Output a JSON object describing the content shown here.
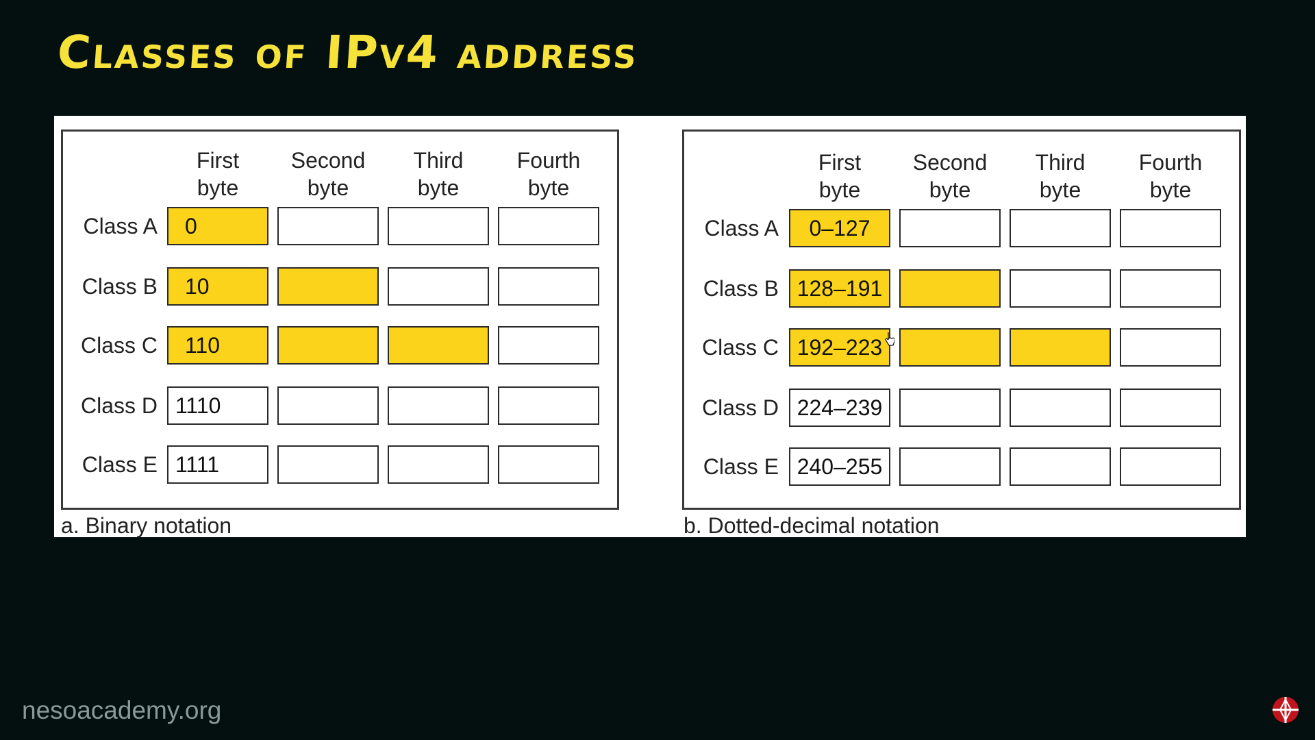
{
  "slide": {
    "title": "Classes of IPv4 address",
    "watermark": "nesoacademy.org"
  },
  "colors": {
    "background": "#03100f",
    "title": "#f7e23a",
    "highlight": "#fbd31a",
    "watermark": "#8a9a98"
  },
  "binary_panel": {
    "caption": "a. Binary notation",
    "columns": [
      "First",
      "byte",
      "Second",
      "byte",
      "Third",
      "byte",
      "Fourth",
      "byte"
    ],
    "rows": [
      {
        "label": "Class A",
        "first_byte": "0",
        "highlighted_bytes": 1
      },
      {
        "label": "Class B",
        "first_byte": "10",
        "highlighted_bytes": 2
      },
      {
        "label": "Class C",
        "first_byte": "110",
        "highlighted_bytes": 3
      },
      {
        "label": "Class D",
        "first_byte": "1110",
        "highlighted_bytes": 0
      },
      {
        "label": "Class E",
        "first_byte": "1111",
        "highlighted_bytes": 0
      }
    ]
  },
  "decimal_panel": {
    "caption": "b. Dotted-decimal notation",
    "columns": [
      "First",
      "byte",
      "Second",
      "byte",
      "Third",
      "byte",
      "Fourth",
      "byte"
    ],
    "rows": [
      {
        "label": "Class A",
        "first_byte": "0–127",
        "highlighted_bytes": 1
      },
      {
        "label": "Class B",
        "first_byte": "128–191",
        "highlighted_bytes": 2
      },
      {
        "label": "Class C",
        "first_byte": "192–223",
        "highlighted_bytes": 3
      },
      {
        "label": "Class D",
        "first_byte": "224–239",
        "highlighted_bytes": 0
      },
      {
        "label": "Class E",
        "first_byte": "240–255",
        "highlighted_bytes": 0
      }
    ]
  },
  "icons": {
    "logo": "neso-logo-icon",
    "cursor": "hand-cursor-icon"
  }
}
